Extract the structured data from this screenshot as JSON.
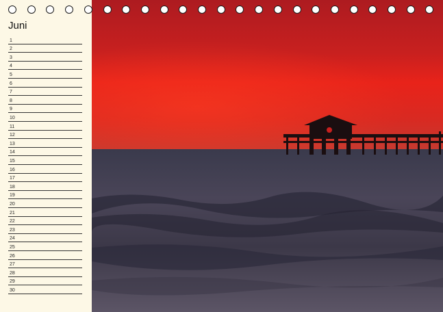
{
  "calendar": {
    "month": "Juni",
    "days": [
      "1",
      "2",
      "3",
      "4",
      "5",
      "6",
      "7",
      "8",
      "9",
      "10",
      "11",
      "12",
      "13",
      "14",
      "15",
      "16",
      "17",
      "18",
      "19",
      "20",
      "21",
      "22",
      "23",
      "24",
      "25",
      "26",
      "27",
      "28",
      "29",
      "30"
    ]
  },
  "photo": {
    "subject": "pier-at-sunset-icon",
    "colors": {
      "sky_top": "#b81e22",
      "sky_glow": "#e8231a",
      "sea_dark": "#2e2e40",
      "sea_light": "#5b5566"
    }
  },
  "binding": {
    "hole_count": 23
  }
}
